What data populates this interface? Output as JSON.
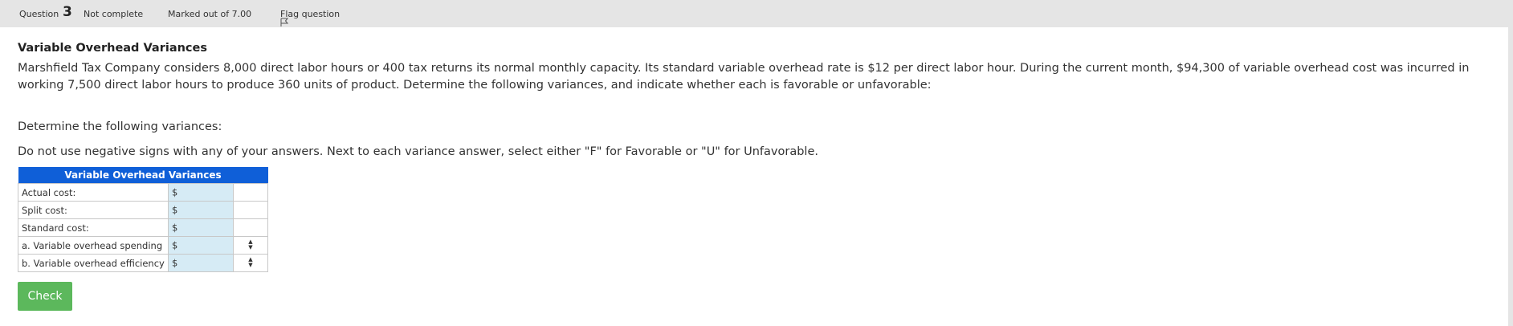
{
  "info": {
    "question_label": "Question",
    "question_number": "3",
    "state": "Not complete",
    "grade": "Marked out of 7.00",
    "flag_label": "Flag question",
    "flag_icon": "flag-icon"
  },
  "question": {
    "title": "Variable Overhead Variances",
    "text": "Marshfield Tax Company considers 8,000 direct labor hours or 400 tax returns its normal monthly capacity. Its standard variable overhead rate is $12 per direct labor hour. During the current month, $94,300 of variable overhead cost was incurred in working 7,500 direct labor hours to produce 360 units of product. Determine the following variances, and indicate whether each is favorable or unfavorable:",
    "instruction1": "Determine the following variances:",
    "instruction2": "Do not use negative signs with any of your answers. Next to each variance answer, select either \"F\" for Favorable or \"U\" for Unfavorable."
  },
  "table": {
    "header": "Variable Overhead Variances",
    "rows": [
      {
        "label": "Actual cost:",
        "currency": "$",
        "value": "",
        "has_select": false
      },
      {
        "label": "Split cost:",
        "currency": "$",
        "value": "",
        "has_select": false
      },
      {
        "label": "Standard cost:",
        "currency": "$",
        "value": "",
        "has_select": false
      },
      {
        "label": "a. Variable overhead spending",
        "currency": "$",
        "value": "",
        "has_select": true
      },
      {
        "label": "b. Variable overhead efficiency",
        "currency": "$",
        "value": "",
        "has_select": true
      }
    ]
  },
  "actions": {
    "check_label": "Check"
  },
  "colors": {
    "header_blue": "#0f5fd8",
    "input_bg": "#d6ebf5",
    "check_green": "#5cb85c",
    "info_bar_bg": "#e5e5e5"
  }
}
